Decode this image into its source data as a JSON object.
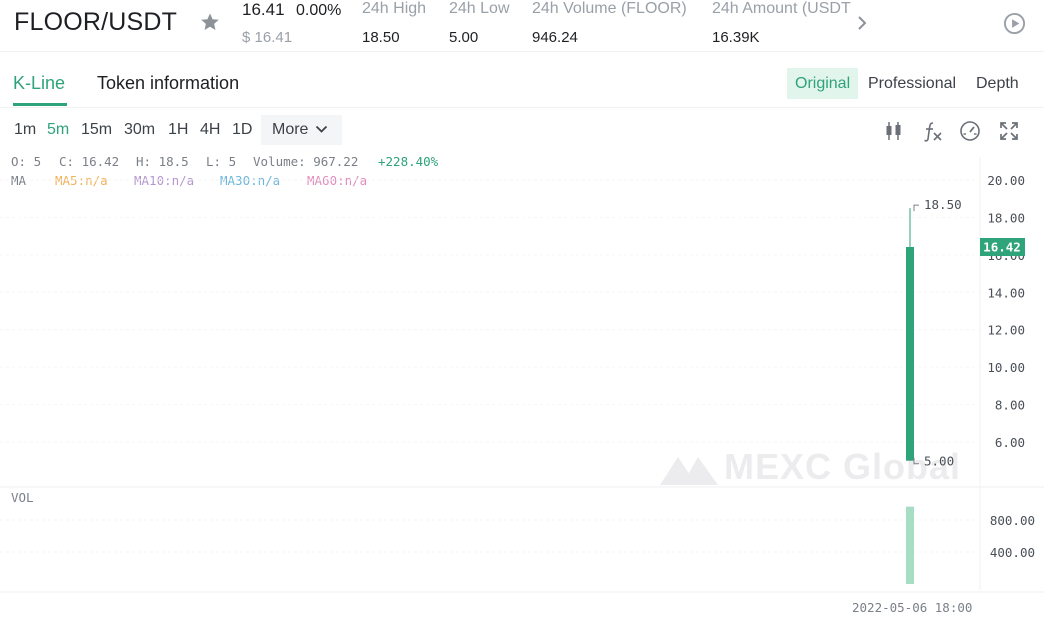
{
  "ticker": {
    "pair": "FLOOR/USDT",
    "last_price": "16.41",
    "change": "0.00%",
    "usd_price": "$ 16.41",
    "stats": [
      {
        "label": "24h High",
        "value": "18.50"
      },
      {
        "label": "24h Low",
        "value": "5.00"
      },
      {
        "label": "24h Volume (FLOOR)",
        "value": "946.24"
      },
      {
        "label": "24h Amount (USDT",
        "value": "16.39K"
      }
    ]
  },
  "tabs": [
    "K-Line",
    "Token information"
  ],
  "views": [
    "Original",
    "Professional",
    "Depth"
  ],
  "intervals": [
    "1m",
    "5m",
    "15m",
    "30m",
    "1H",
    "4H",
    "1D"
  ],
  "more_label": "More",
  "tools": [
    "candlestick-type-icon",
    "indicator-fx-icon",
    "gauge-icon",
    "fullscreen-icon"
  ],
  "ohlc": {
    "o": "O: 5",
    "c": "C: 16.42",
    "h": "H: 18.5",
    "l": "L: 5",
    "volume": "Volume: 967.22",
    "pct": "+228.40%"
  },
  "ma": {
    "label": "MA",
    "ma5": "MA5:n/a",
    "ma10": "MA10:n/a",
    "ma30": "MA30:n/a",
    "ma60": "MA60:n/a"
  },
  "colors": {
    "accent": "#2fa37a",
    "ma5": "#f0b35b",
    "ma10": "#b596cf",
    "ma30": "#6fb6dc",
    "ma60": "#e28dbd"
  },
  "price_axis": [
    "20.00",
    "18.00",
    "16.00",
    "14.00",
    "12.00",
    "10.00",
    "8.00",
    "6.00"
  ],
  "volume_axis": [
    "800.00",
    "400.00"
  ],
  "candle": {
    "open": 5,
    "high": 18.5,
    "low": 5,
    "close": 16.42,
    "volume": 967.22
  },
  "high_marker": "18.50",
  "low_marker": "5.00",
  "last_price_tag": "16.42",
  "watermark": "MEXC Global",
  "vol_label": "VOL",
  "time_label": "2022-05-06 18:00"
}
